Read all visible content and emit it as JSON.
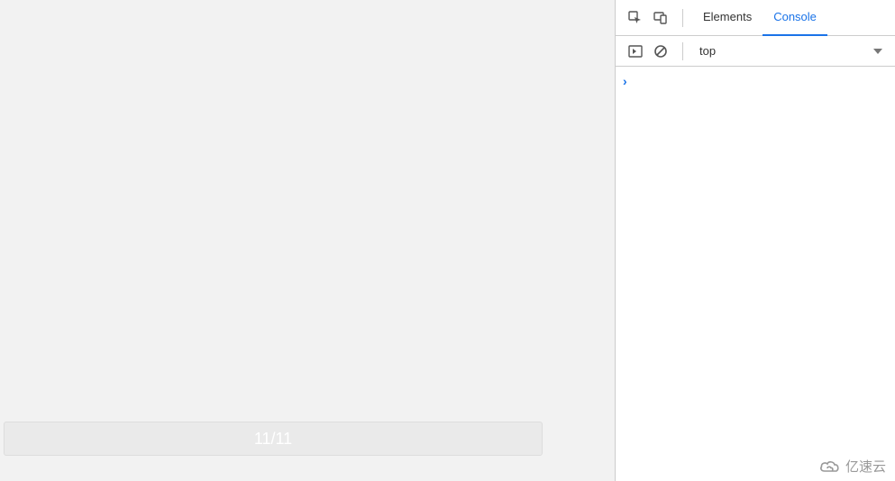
{
  "left": {
    "page_indicator": "11/11"
  },
  "devtools": {
    "tabs": {
      "elements": "Elements",
      "console": "Console"
    },
    "toolbar": {
      "context": "top"
    },
    "prompt": ""
  },
  "watermark": {
    "text": "亿速云"
  }
}
